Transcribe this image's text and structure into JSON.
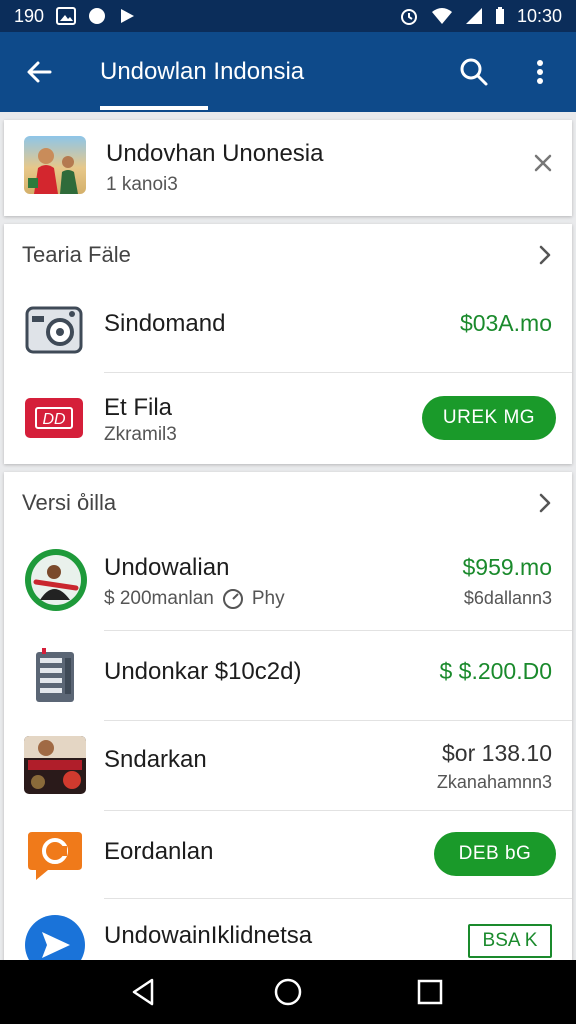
{
  "status_bar": {
    "time_left": "190",
    "time_right": "10:30"
  },
  "app_bar": {
    "title": "Undowlan Indonsia",
    "icons": [
      "back-arrow-icon",
      "search-icon",
      "more-vert-icon"
    ]
  },
  "header_card": {
    "title": "Undovhan Unonesia",
    "subtitle": "1 kanoi3"
  },
  "files_section": {
    "title": "Tearia Fäle",
    "items": [
      {
        "title": "Sindomand",
        "price": "$03A.mo"
      },
      {
        "title": "Et Fila",
        "subtitle": "Zkramil3",
        "button": "UREK MG"
      }
    ]
  },
  "versi_section": {
    "title": "Versi o̊illa",
    "items": [
      {
        "title": "Undowalian",
        "subtitle": "$ 200manlan",
        "subtitle2": "Phy",
        "price": "$959.mo",
        "price_sub": "$6dallann3"
      },
      {
        "title": "Undonkar $10c2d)",
        "price": "$ $.200.D0"
      },
      {
        "title": "Sndarkan",
        "price": "$or 138.10",
        "price_sub": "Zkanahamnn3"
      },
      {
        "title": "Eordanlan",
        "button": "DEB bG"
      },
      {
        "title": "UndowainIklidnetsa",
        "button": "BSA K"
      }
    ]
  },
  "colors": {
    "status_bar": "#0b2d5a",
    "app_bar": "#0e4a8a",
    "accent_green": "#1a9a2a"
  }
}
